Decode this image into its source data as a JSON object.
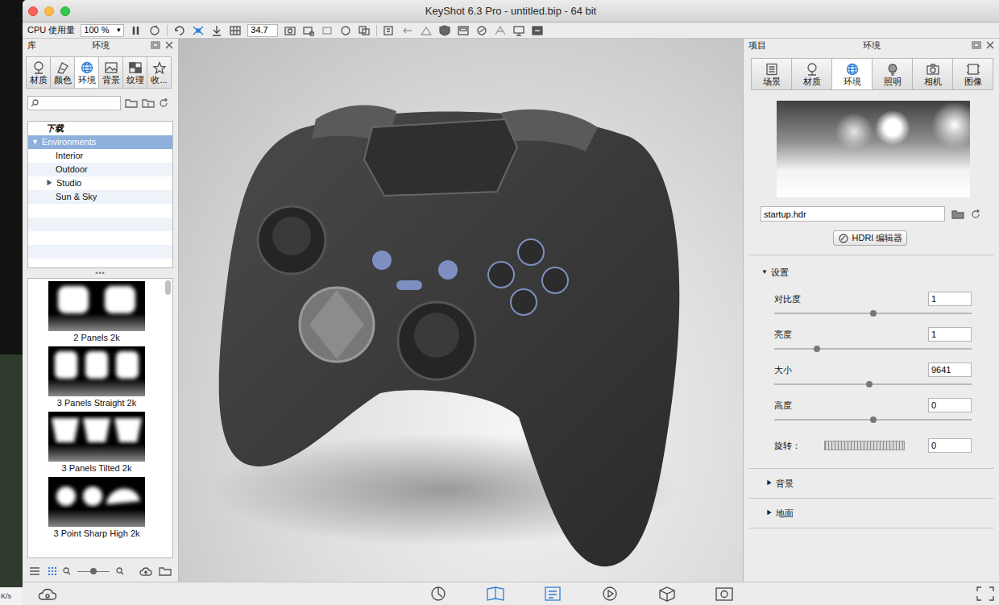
{
  "desktop": {
    "corner_label": "K/s"
  },
  "window": {
    "title": "KeyShot 6.3 Pro - untitled.bip - 64 bit"
  },
  "toolbar": {
    "cpu_label": "CPU 使用量",
    "cpu_value": "100 %",
    "dropdown_arrow": "▾",
    "fov_value": "34.7"
  },
  "library": {
    "title": "库",
    "subtitle": "环境",
    "tabs": [
      {
        "label": "材质",
        "selected": false
      },
      {
        "label": "颜色",
        "selected": false
      },
      {
        "label": "环境",
        "selected": true
      },
      {
        "label": "背景",
        "selected": false
      },
      {
        "label": "纹理",
        "selected": false
      },
      {
        "label": "收...",
        "selected": false
      }
    ],
    "tree": [
      {
        "label": "下载",
        "kind": "heading",
        "selected": false
      },
      {
        "label": "Environments",
        "kind": "group",
        "toggle": "▼",
        "expanded": true,
        "selected": true
      },
      {
        "label": "Interior",
        "kind": "leaf",
        "selected": false
      },
      {
        "label": "Outdoor",
        "kind": "leaf",
        "selected": false
      },
      {
        "label": "Studio",
        "kind": "subgroup",
        "toggle": "▶",
        "expanded": false,
        "selected": false
      },
      {
        "label": "Sun & Sky",
        "kind": "leaf",
        "selected": false
      }
    ],
    "more": "•••",
    "thumbnails": [
      {
        "label": "2 Panels 2k",
        "kind": "two"
      },
      {
        "label": "3 Panels Straight 2k",
        "kind": "straight"
      },
      {
        "label": "3 Panels Tilted 2k",
        "kind": "tilted"
      },
      {
        "label": "3 Point Sharp High 2k",
        "kind": "points"
      }
    ]
  },
  "project": {
    "title": "项目",
    "subtitle": "环境",
    "tabs": [
      {
        "label": "场景",
        "selected": false
      },
      {
        "label": "材质",
        "selected": false
      },
      {
        "label": "环境",
        "selected": true
      },
      {
        "label": "照明",
        "selected": false
      },
      {
        "label": "相机",
        "selected": false
      },
      {
        "label": "图像",
        "selected": false
      }
    ],
    "hdri_file": "startup.hdr",
    "editor_button": "HDRI 编辑器",
    "settings": {
      "label": "设置",
      "toggle": "▼",
      "expanded": true
    },
    "sliders": [
      {
        "label": "对比度",
        "value": "1",
        "level": 0.5
      },
      {
        "label": "亮度",
        "value": "1",
        "level": 0.215
      },
      {
        "label": "大小",
        "value": "9641",
        "level": 0.48
      },
      {
        "label": "高度",
        "value": "0",
        "level": 0.5
      }
    ],
    "rotation": {
      "label": "旋转：",
      "value": "0"
    },
    "sections": [
      {
        "label": "背景",
        "toggle": "▶",
        "expanded": false
      },
      {
        "label": "地面",
        "toggle": "▶",
        "expanded": false
      }
    ]
  }
}
